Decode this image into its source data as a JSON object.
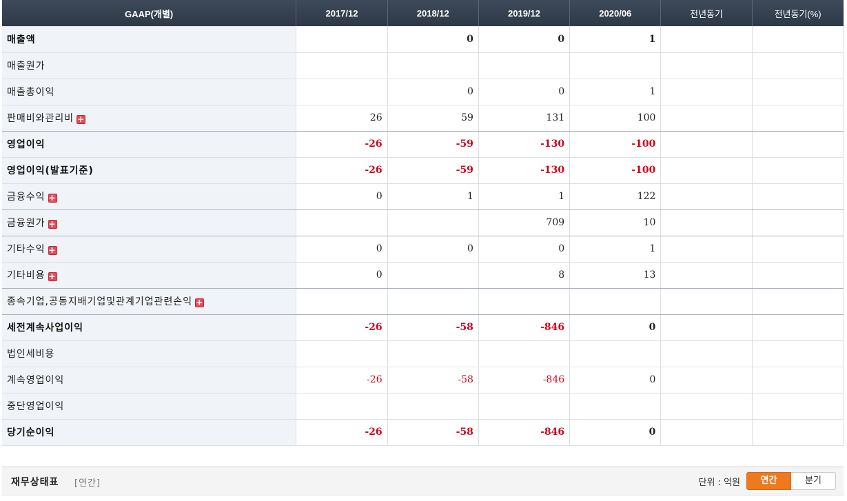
{
  "table": {
    "headers": [
      "GAAP(개별)",
      "2017/12",
      "2018/12",
      "2019/12",
      "2020/06",
      "전년동기",
      "전년동기(%)"
    ],
    "rows": [
      {
        "label": "매출액",
        "bold": true,
        "expand": false,
        "sep": false,
        "values": [
          "",
          "0",
          "0",
          "1",
          "",
          ""
        ]
      },
      {
        "label": "매출원가",
        "bold": false,
        "expand": false,
        "sep": false,
        "values": [
          "",
          "",
          "",
          "",
          "",
          ""
        ]
      },
      {
        "label": "매출총이익",
        "bold": false,
        "expand": false,
        "sep": false,
        "values": [
          "",
          "0",
          "0",
          "1",
          "",
          ""
        ]
      },
      {
        "label": "판매비와관리비",
        "bold": false,
        "expand": true,
        "sep": true,
        "values": [
          "26",
          "59",
          "131",
          "100",
          "",
          ""
        ]
      },
      {
        "label": "영업이익",
        "bold": true,
        "expand": false,
        "sep": false,
        "values": [
          "-26",
          "-59",
          "-130",
          "-100",
          "",
          ""
        ]
      },
      {
        "label": "영업이익(발표기준)",
        "bold": true,
        "expand": false,
        "sep": false,
        "values": [
          "-26",
          "-59",
          "-130",
          "-100",
          "",
          ""
        ]
      },
      {
        "label": "금융수익",
        "bold": false,
        "expand": true,
        "sep": true,
        "values": [
          "0",
          "1",
          "1",
          "122",
          "",
          ""
        ]
      },
      {
        "label": "금융원가",
        "bold": false,
        "expand": true,
        "sep": true,
        "values": [
          "",
          "",
          "709",
          "10",
          "",
          ""
        ]
      },
      {
        "label": "기타수익",
        "bold": false,
        "expand": true,
        "sep": false,
        "values": [
          "0",
          "0",
          "0",
          "1",
          "",
          ""
        ]
      },
      {
        "label": "기타비용",
        "bold": false,
        "expand": true,
        "sep": true,
        "values": [
          "0",
          "",
          "8",
          "13",
          "",
          ""
        ]
      },
      {
        "label": "종속기업,공동지배기업및관계기업관련손익",
        "bold": false,
        "expand": true,
        "sep": true,
        "values": [
          "",
          "",
          "",
          "",
          "",
          ""
        ]
      },
      {
        "label": "세전계속사업이익",
        "bold": true,
        "expand": false,
        "sep": false,
        "values": [
          "-26",
          "-58",
          "-846",
          "0",
          "",
          ""
        ]
      },
      {
        "label": "법인세비용",
        "bold": false,
        "expand": false,
        "sep": false,
        "values": [
          "",
          "",
          "",
          "",
          "",
          ""
        ]
      },
      {
        "label": "계속영업이익",
        "bold": false,
        "expand": false,
        "sep": false,
        "values": [
          "-26",
          "-58",
          "-846",
          "0",
          "",
          ""
        ]
      },
      {
        "label": "중단영업이익",
        "bold": false,
        "expand": false,
        "sep": false,
        "values": [
          "",
          "",
          "",
          "",
          "",
          ""
        ]
      },
      {
        "label": "당기순이익",
        "bold": true,
        "expand": false,
        "sep": false,
        "values": [
          "-26",
          "-58",
          "-846",
          "0",
          "",
          ""
        ]
      }
    ],
    "expand_icon": "plus-icon",
    "expand_symbol": "+"
  },
  "footer": {
    "title": "재무상태표",
    "subtitle": "[연간]",
    "unit": "단위 : 억원",
    "toggle": [
      "연간",
      "분기"
    ],
    "active": "연간"
  },
  "colors": {
    "header_bg": "#34404e",
    "negative": "#d0021b",
    "label_bg": "#f0f3f7",
    "toggle_active": "#ee7a1f"
  }
}
